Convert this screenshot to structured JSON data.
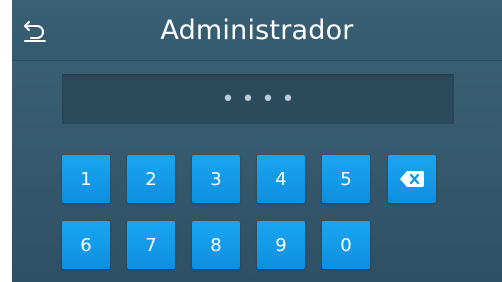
{
  "header": {
    "title": "Administrador",
    "back_icon": "back-arrow-icon"
  },
  "pin": {
    "masked_value": "••••"
  },
  "keypad": {
    "keys": [
      "1",
      "2",
      "3",
      "4",
      "5",
      "6",
      "7",
      "8",
      "9",
      "0"
    ],
    "backspace_icon": "backspace-icon"
  },
  "colors": {
    "background": "#36596d",
    "key": "#1aa6f0",
    "display": "#2c4a5b",
    "text": "#ffffff"
  }
}
